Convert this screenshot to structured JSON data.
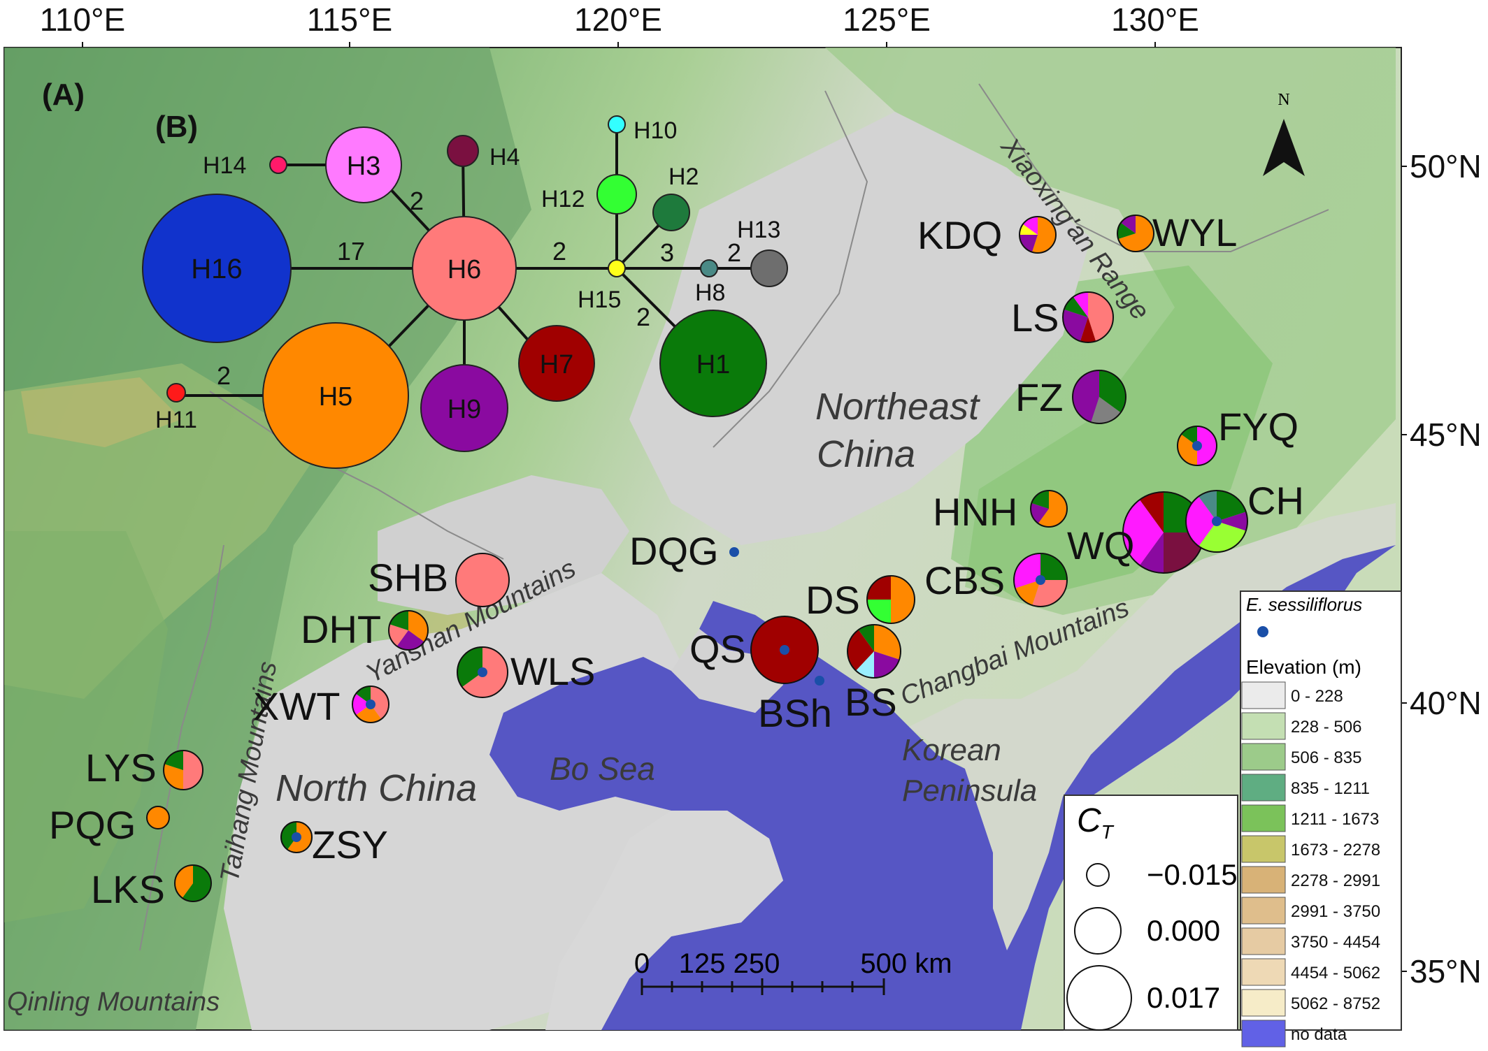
{
  "panel_labels": {
    "a": "(A)",
    "b": "(B)"
  },
  "lon_ticks": [
    "110°E",
    "115°E",
    "120°E",
    "125°E",
    "130°E"
  ],
  "lat_ticks": [
    "50°N",
    "45°N",
    "40°N",
    "35°N"
  ],
  "north_label": "N",
  "regions": {
    "northeast_1": "Northeast",
    "northeast_2": "China",
    "north_china": "North China",
    "bo_sea": "Bo Sea",
    "korean_1": "Korean",
    "korean_2": "Peninsula"
  },
  "mountains": {
    "xiaoxingan": "Xiaoxing'an Range",
    "yanshan": "Yanshan Mountains",
    "changbai": "Changbai Mountains",
    "taihang": "Taihang Mountains",
    "qinling": "Qinling Mountains"
  },
  "populations": [
    "KDQ",
    "WYL",
    "LS",
    "FZ",
    "FYQ",
    "HNH",
    "WQ",
    "CH",
    "CBS",
    "DS",
    "BS",
    "QS",
    "BSh",
    "DQG",
    "SHB",
    "DHT",
    "WLS",
    "XWT",
    "LYS",
    "PQG",
    "ZSY",
    "LKS"
  ],
  "haplotypes": [
    "H1",
    "H2",
    "H3",
    "H4",
    "H5",
    "H6",
    "H7",
    "H8",
    "H9",
    "H10",
    "H11",
    "H12",
    "H13",
    "H14",
    "H15",
    "H16"
  ],
  "network_edge_labels": [
    "2",
    "17",
    "2",
    "3",
    "2",
    "2",
    "2"
  ],
  "scale_bar": {
    "labels": [
      "0",
      "125",
      "250",
      "500 km"
    ]
  },
  "ct_legend": {
    "title": "C",
    "subscript": "T",
    "values": [
      "−0.015",
      "0.000",
      "0.017"
    ]
  },
  "elevation_legend": {
    "species": "E. sessiliflorus",
    "title": "Elevation (m)",
    "classes": [
      {
        "label": "0 - 228",
        "color": "#ebebeb"
      },
      {
        "label": "228 - 506",
        "color": "#c4dfb3"
      },
      {
        "label": "506 - 835",
        "color": "#9ccb8a"
      },
      {
        "label": "835 - 1211",
        "color": "#5fad82"
      },
      {
        "label": "1211 - 1673",
        "color": "#7bc25a"
      },
      {
        "label": "1673 - 2278",
        "color": "#c8c66a"
      },
      {
        "label": "2278 - 2991",
        "color": "#d8b277"
      },
      {
        "label": "2991 - 3750",
        "color": "#dfbe8c"
      },
      {
        "label": "3750 - 4454",
        "color": "#e6cba3"
      },
      {
        "label": "4454 - 5062",
        "color": "#eed9b5"
      },
      {
        "label": "5062 - 8752",
        "color": "#f6ecc8"
      },
      {
        "label": "no data",
        "color": "#6161e6"
      }
    ]
  },
  "colors": {
    "sea": "#5656c4",
    "land_low": "#d2d2d2",
    "H1": "#0a7a0a",
    "H2": "#1e7a3c",
    "H3": "#ff7aff",
    "H4": "#7a1040",
    "H5": "#ff8800",
    "H6": "#ff7a7a",
    "H7": "#a00000",
    "H8": "#4a8a86",
    "H9": "#8a0aa0",
    "H10": "#33ffff",
    "H11": "#ff1a1a",
    "H12": "#33ff33",
    "H13": "#6e6e6e",
    "H14": "#ff1a6a",
    "H15": "#ffff1a",
    "H16": "#1133cc",
    "magenta": "#ff1aff",
    "yellow": "#ffff1a",
    "grey": "#808080",
    "lime": "#99ff33",
    "sky": "#99eeff",
    "presence": "#1a4fa8"
  }
}
